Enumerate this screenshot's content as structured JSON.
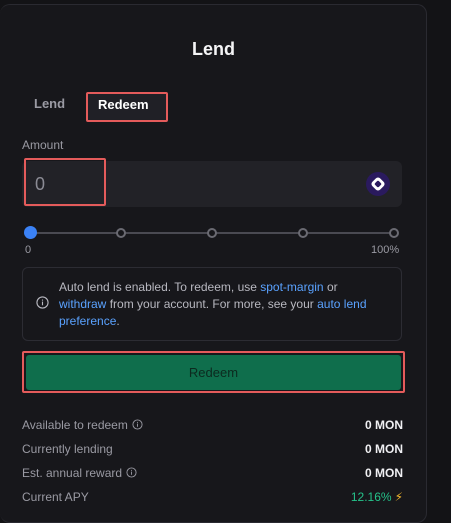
{
  "panel": {
    "title": "Lend"
  },
  "tabs": {
    "lend_label": "Lend",
    "redeem_label": "Redeem",
    "active": "Redeem"
  },
  "amount": {
    "label": "Amount",
    "value": "0",
    "token_icon": "monad-token-icon"
  },
  "slider": {
    "min_label": "0",
    "max_label": "100%",
    "value_percent": 0,
    "steps": [
      0,
      25,
      50,
      75,
      100
    ]
  },
  "notice": {
    "text_1": "Auto lend is enabled. To redeem, use ",
    "link_1": "spot-margin",
    "text_2": " or ",
    "link_2": "withdraw",
    "text_3": " from your account. For more, see your ",
    "link_3": "auto lend preference",
    "text_4": "."
  },
  "redeem_button": {
    "label": "Redeem"
  },
  "stats": {
    "available_label": "Available to redeem",
    "available_value": "0 MON",
    "lending_label": "Currently lending",
    "lending_value": "0 MON",
    "reward_label": "Est. annual reward",
    "reward_value": "0 MON",
    "apy_label": "Current APY",
    "apy_value": "12.16%"
  },
  "colors": {
    "accent": "#3b82f6",
    "link": "#5aa2ff",
    "button": "#0f6e4c",
    "apy": "#25c28a",
    "highlight": "#e45b5b"
  }
}
